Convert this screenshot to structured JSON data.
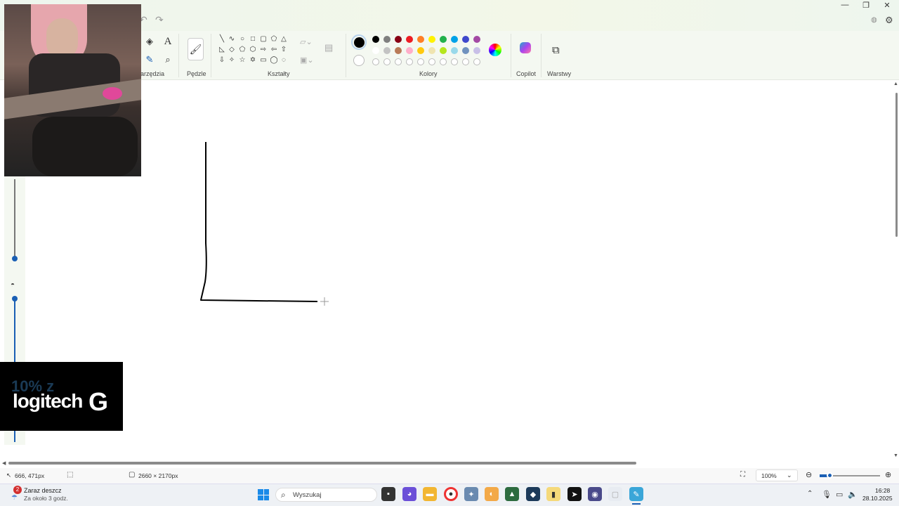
{
  "ribbon": {
    "tools_label": "arzędzia",
    "brushes_label": "Pędzle",
    "shapes_label": "Kształty",
    "colors_label": "Kolory",
    "copilot_label": "Copilot",
    "layers_label": "Warstwy"
  },
  "colors": {
    "primary": "#000000",
    "secondary": "#ffffff",
    "palette_row1": [
      "#000000",
      "#7f7f7f",
      "#880015",
      "#ed1c24",
      "#ff7f27",
      "#fff200",
      "#22b14c",
      "#00a2e8",
      "#3f48cc",
      "#a349a4"
    ],
    "palette_row2": [
      "#ffffff",
      "#c3c3c3",
      "#b97a57",
      "#ffaec9",
      "#ffc90e",
      "#efe4b0",
      "#b5e61d",
      "#99d9ea",
      "#7092be",
      "#c8bfe7"
    ]
  },
  "status": {
    "cursor_pos": "666, 471px",
    "canvas_size": "2660 × 2170px",
    "zoom": "100%"
  },
  "taskbar": {
    "weather_badge": "2",
    "weather_title": "Zaraz deszcz",
    "weather_sub": "Za około 3 godz.",
    "search_placeholder": "Wyszukaj",
    "time": "16:28",
    "date": "28.10.2025"
  },
  "overlay": {
    "logo_text": "logitech",
    "logo_mark": "G",
    "ghost_text": "10% z"
  }
}
